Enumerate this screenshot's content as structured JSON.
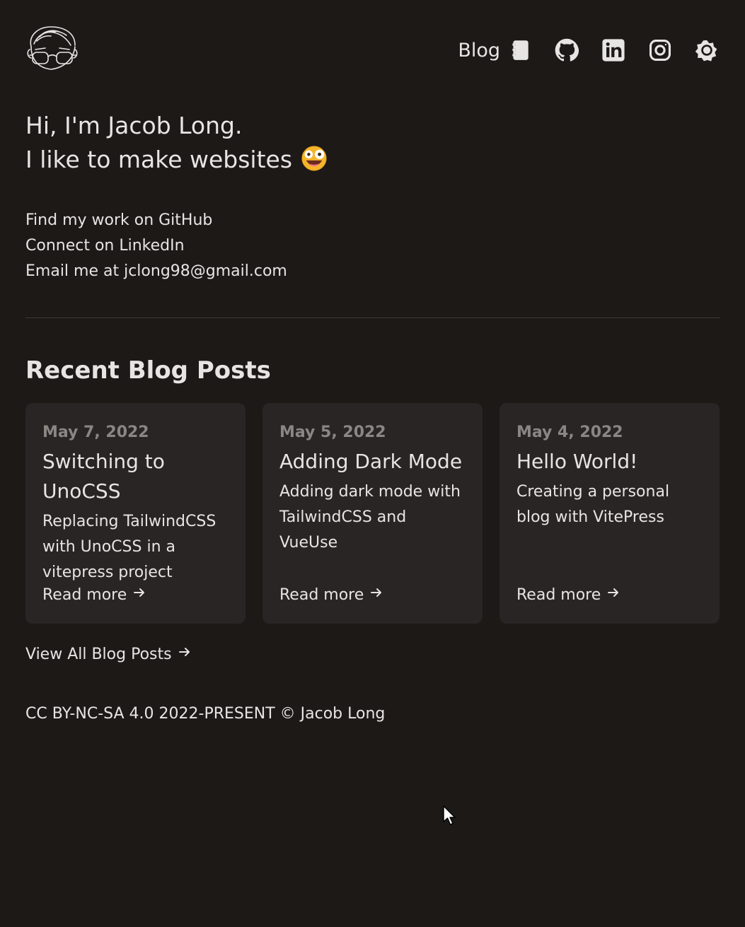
{
  "header": {
    "nav": {
      "blog_label": "Blog"
    }
  },
  "intro": {
    "line1": "Hi, I'm Jacob Long.",
    "line2": "I like to make websites",
    "emoji": "zany-face-emoji"
  },
  "links": {
    "github": "Find my work on GitHub",
    "linkedin": "Connect on LinkedIn",
    "email": "Email me at jclong98@gmail.com"
  },
  "section": {
    "title": "Recent Blog Posts"
  },
  "posts": [
    {
      "date": "May 7, 2022",
      "title": "Switching to UnoCSS",
      "description": "Replacing TailwindCSS with UnoCSS in a vitepress project",
      "read_more": "Read more"
    },
    {
      "date": "May 5, 2022",
      "title": "Adding Dark Mode",
      "description": "Adding dark mode with TailwindCSS and VueUse",
      "read_more": "Read more"
    },
    {
      "date": "May 4, 2022",
      "title": "Hello World!",
      "description": "Creating a personal blog with VitePress",
      "read_more": "Read more"
    }
  ],
  "view_all": "View All Blog Posts",
  "footer": "CC BY-NC-SA 4.0 2022-PRESENT © Jacob Long",
  "icons": {
    "logo": "avatar-logo",
    "blog": "notebook-icon",
    "github": "github-icon",
    "linkedin": "linkedin-icon",
    "instagram": "instagram-icon",
    "theme": "sun-icon",
    "arrow": "arrow-right-icon"
  },
  "colors": {
    "background": "#1c1917",
    "card": "#292524",
    "text": "#e7e5e4",
    "muted": "#8b8683"
  }
}
